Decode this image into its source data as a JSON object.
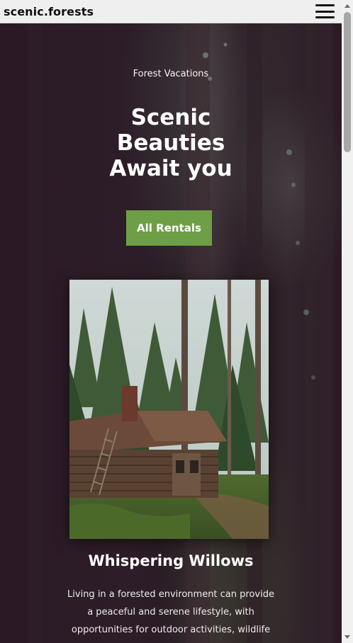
{
  "header": {
    "brand": "scenic.forests",
    "menu_icon": "hamburger-menu-icon"
  },
  "hero": {
    "eyebrow": "Forest Vacations",
    "headline_lines": [
      "Scenic",
      "Beauties",
      "Await you"
    ],
    "cta_label": "All Rentals"
  },
  "rental": {
    "image_desc_icon": "cabin-photo",
    "title": "Whispering Willows",
    "description": "Living in a forested environment can provide a peaceful and serene lifestyle, with opportunities for outdoor activities, wildlife observation, and a strong connection to the"
  },
  "colors": {
    "header_bg": "#efefef",
    "hero_bg": "#2a1a24",
    "cta_bg": "#6e9e45",
    "text_light": "#ffffff"
  }
}
